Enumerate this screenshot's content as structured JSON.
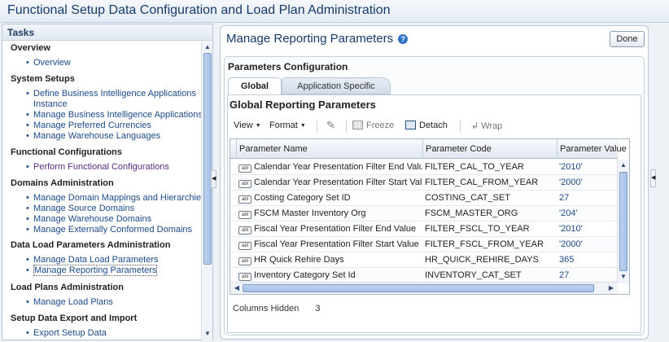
{
  "app": {
    "title": "Functional Setup Data Configuration and Load Plan Administration"
  },
  "tasks": {
    "header": "Tasks",
    "sections": [
      {
        "title": "Overview",
        "items": [
          "Overview"
        ]
      },
      {
        "title": "System Setups",
        "items": [
          "Define Business Intelligence Applications",
          "Instance",
          "Manage Business Intelligence Applications",
          "Manage Preferred Currencies",
          "Manage Warehouse Languages"
        ]
      },
      {
        "title": "Functional Configurations",
        "items": [
          "Perform Functional Configurations"
        ]
      },
      {
        "title": "Domains Administration",
        "items": [
          "Manage Domain Mappings and Hierarchies",
          "Manage Source Domains",
          "Manage Warehouse Domains",
          "Manage Externally Conformed Domains"
        ]
      },
      {
        "title": "Data Load Parameters Administration",
        "items": [
          "Manage Data Load Parameters",
          "Manage Reporting Parameters"
        ]
      },
      {
        "title": "Load Plans Administration",
        "items": [
          "Manage Load Plans"
        ]
      },
      {
        "title": "Setup Data Export and Import",
        "items": [
          "Export Setup Data"
        ]
      }
    ]
  },
  "main": {
    "title": "Manage Reporting Parameters",
    "done_label": "Done",
    "config_title": "Parameters Configuration",
    "tabs": [
      "Global",
      "Application Specific"
    ],
    "section_title": "Global Reporting Parameters",
    "toolbar": {
      "view": "View",
      "format": "Format",
      "freeze": "Freeze",
      "detach": "Detach",
      "wrap": "Wrap"
    },
    "table": {
      "columns": [
        "Parameter Name",
        "Parameter Code",
        "Parameter Value"
      ],
      "rows": [
        {
          "name": "Calendar Year Presentation Filter End Value",
          "code": "FILTER_CAL_TO_YEAR",
          "value": "'2010'"
        },
        {
          "name": "Calendar Year Presentation Filter Start Value",
          "code": "FILTER_CAL_FROM_YEAR",
          "value": "'2000'"
        },
        {
          "name": "Costing Category Set ID",
          "code": "COSTING_CAT_SET",
          "value": "27"
        },
        {
          "name": "FSCM Master Inventory Org",
          "code": "FSCM_MASTER_ORG",
          "value": "'204'"
        },
        {
          "name": "Fiscal Year Presentation Filter End Value",
          "code": "FILTER_FSCL_TO_YEAR",
          "value": "'2010'"
        },
        {
          "name": "Fiscal Year Presentation Filter Start Value",
          "code": "FILTER_FSCL_FROM_YEAR",
          "value": "'2000'"
        },
        {
          "name": "HR Quick Rehire Days",
          "code": "HR_QUICK_REHIRE_DAYS",
          "value": "365"
        },
        {
          "name": "Inventory Category Set Id",
          "code": "INVENTORY_CAT_SET",
          "value": "27"
        }
      ],
      "type_icon_text": "abl"
    },
    "footer": {
      "label": "Columns Hidden",
      "count": "3"
    }
  }
}
